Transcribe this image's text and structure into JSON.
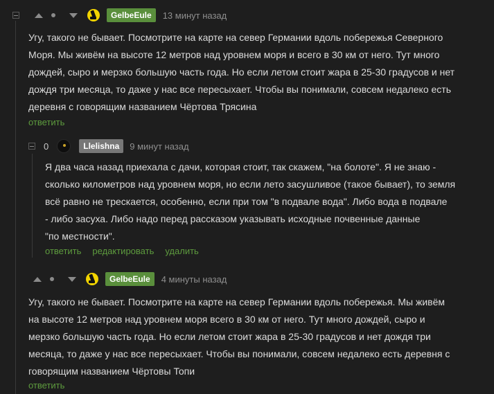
{
  "comments": [
    {
      "username": "GelbeEule",
      "time": "13 минут назад",
      "lines": [
        "Угу, такого не бывает. Посмотрите на карте на север Германии вдоль побережья Северного",
        "Моря. Мы живём на высоте 12 метров над уровнем моря и всего в 30 км от него. Тут много",
        "дождей, сыро и мерзко большую часть года. Но если летом стоит жара в 25-30 градусов и нет",
        "дождя три месяца, то даже у нас все пересыхает. Чтобы вы понимали, совсем недалеко есть",
        "деревня с говорящим названием Чёртова Трясина"
      ],
      "reply_label": "ответить"
    },
    {
      "rating": "0",
      "username": "Llelishna",
      "time": "9 минут назад",
      "lines": [
        "Я два часа назад приехала с дачи, которая стоит, так скажем, \"на болоте\". Я не знаю -",
        "сколько километров над уровнем моря, но если лето засушливое (такое бывает), то земля",
        "всё равно не трескается, особенно, если при том \"в подвале вода\". Либо вода в подвале",
        "- либо засуха. Либо надо перед рассказом указывать исходные почвенные данные",
        "\"по местности\"."
      ],
      "reply_label": "ответить",
      "edit_label": "редактировать",
      "delete_label": "удалить"
    },
    {
      "username": "GelbeEule",
      "time": "4 минуты назад",
      "lines": [
        "Угу, такого не бывает. Посмотрите на карте на север Германии вдоль побережья. Мы живём",
        "на высоте 12 метров над уровнем моря всего в 30 км от него. Тут много дождей, сыро и",
        "мерзко большую часть года. Но если летом стоит жара в 25-30 градусов и нет дождя три",
        "месяца, то даже у нас все пересыхает. Чтобы вы понимали, совсем недалеко есть деревня с",
        "говорящим названием Чёртовы Топи"
      ],
      "reply_label": "ответить"
    }
  ],
  "colors": {
    "accent_green": "#5a8f3c",
    "link_green": "#5e9c3e",
    "background": "#1e1e1e"
  }
}
